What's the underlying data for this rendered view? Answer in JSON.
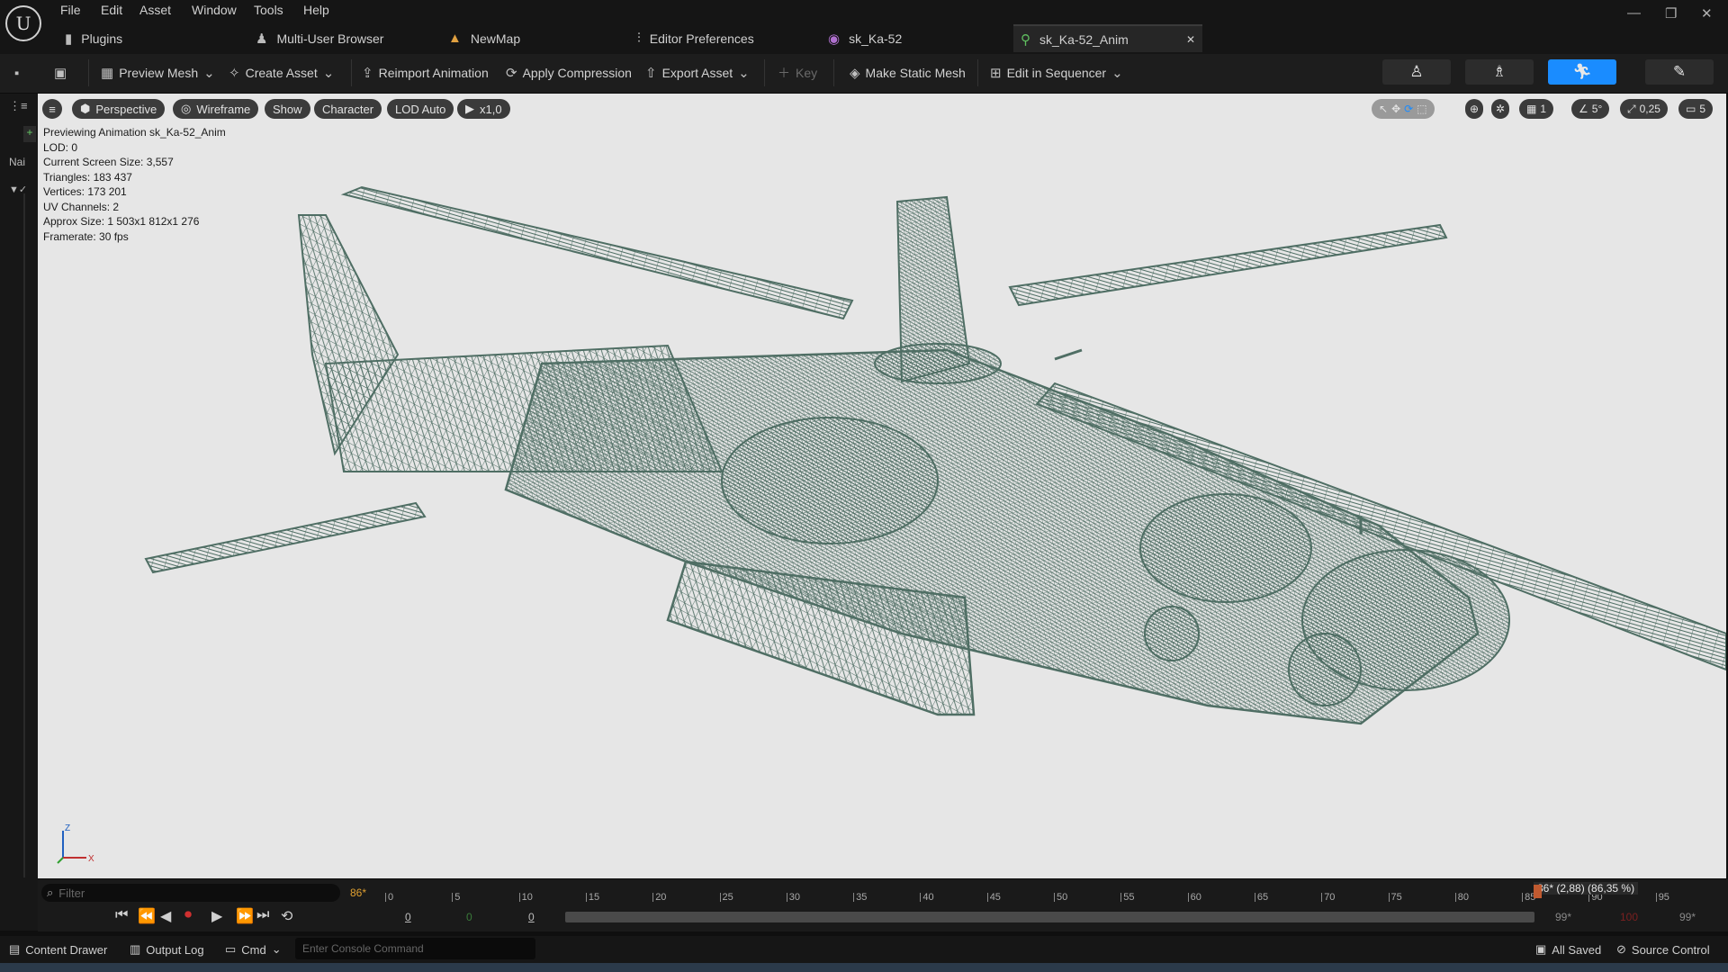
{
  "menu": [
    "File",
    "Edit",
    "Asset",
    "Window",
    "Tools",
    "Help"
  ],
  "tabs": [
    {
      "label": "Plugins",
      "icon": "plug-icon"
    },
    {
      "label": "Multi-User Browser",
      "icon": "users-icon"
    },
    {
      "label": "NewMap",
      "icon": "map-icon"
    },
    {
      "label": "Editor Preferences",
      "icon": "sliders-icon"
    },
    {
      "label": "sk_Ka-52",
      "icon": "skeleton-icon"
    },
    {
      "label": "sk_Ka-52_Anim",
      "icon": "animation-icon"
    }
  ],
  "toolbar": {
    "preview_mesh": "Preview Mesh",
    "create_asset": "Create Asset",
    "reimport": "Reimport Animation",
    "apply_compression": "Apply Compression",
    "export_asset": "Export Asset",
    "key": "Key",
    "make_static_mesh": "Make Static Mesh",
    "edit_in_sequencer": "Edit in Sequencer",
    "active_mode_color": "#1a8cff"
  },
  "viewport": {
    "perspective": "Perspective",
    "wireframe": "Wireframe",
    "show": "Show",
    "character": "Character",
    "lod": "LOD Auto",
    "playrate": "x1,0",
    "snap_grid": "1",
    "snap_angle": "5°",
    "snap_scale": "0,25",
    "camera_speed": "5",
    "wire_color": "#4f6e64",
    "background": "#e6e6e6"
  },
  "stats": [
    "Previewing Animation sk_Ka-52_Anim",
    "LOD: 0",
    "Current Screen Size: 3,557",
    "Triangles: 183 437",
    "Vertices: 173 201",
    "UV Channels: 2",
    "Approx Size: 1 503x1 812x1 276",
    "Framerate: 30 fps"
  ],
  "timeline": {
    "filter_placeholder": "Filter",
    "frame_badge": "86*",
    "ticks": [
      "0",
      "5",
      "10",
      "15",
      "20",
      "25",
      "30",
      "35",
      "40",
      "45",
      "50",
      "55",
      "60",
      "65",
      "70",
      "75",
      "80",
      "85",
      "90",
      "95"
    ],
    "playhead_label": "86* (2,88) (86,35 %)",
    "range_start": "0",
    "range_mid": "0",
    "range_end": "0",
    "end_a": "99*",
    "end_b": "100",
    "end_c": "99*"
  },
  "bottom": {
    "content_drawer": "Content Drawer",
    "output_log": "Output Log",
    "cmd": "Cmd",
    "console_placeholder": "Enter Console Command",
    "all_saved": "All Saved",
    "source_control": "Source Control"
  }
}
